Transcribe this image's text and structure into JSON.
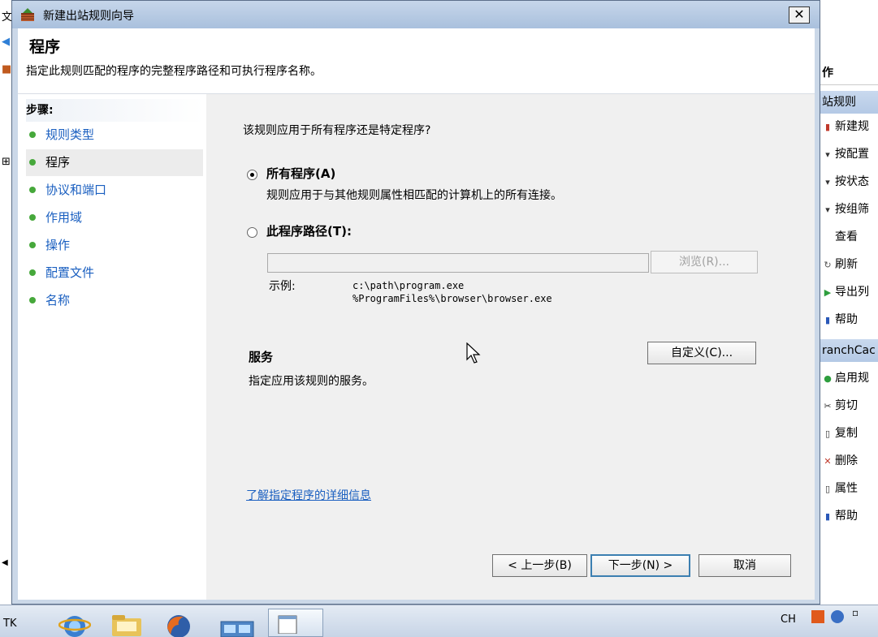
{
  "wizard": {
    "title": "新建出站规则向导",
    "close_glyph": "✕",
    "heading": "程序",
    "description": "指定此规则匹配的程序的完整程序路径和可执行程序名称。"
  },
  "steps": {
    "caption": "步骤:",
    "items": [
      {
        "label": "规则类型",
        "active": false
      },
      {
        "label": "程序",
        "active": true
      },
      {
        "label": "协议和端口",
        "active": false
      },
      {
        "label": "作用域",
        "active": false
      },
      {
        "label": "操作",
        "active": false
      },
      {
        "label": "配置文件",
        "active": false
      },
      {
        "label": "名称",
        "active": false
      }
    ]
  },
  "content": {
    "question": "该规则应用于所有程序还是特定程序?",
    "all_programs": {
      "label": "所有程序(A)",
      "description": "规则应用于与其他规则属性相匹配的计算机上的所有连接。",
      "selected": true
    },
    "this_program": {
      "label": "此程序路径(T):",
      "selected": false,
      "path_value": "",
      "browse_label": "浏览(R)..."
    },
    "example_label": "示例:",
    "example_line1": "c:\\path\\program.exe",
    "example_line2": "%ProgramFiles%\\browser\\browser.exe",
    "services_title": "服务",
    "services_desc": "指定应用该规则的服务。",
    "customize_label": "自定义(C)...",
    "learn_more": "了解指定程序的详细信息"
  },
  "footer": {
    "back_label": "< 上一步(B)",
    "next_label": "下一步(N) >",
    "cancel_label": "取消"
  },
  "background": {
    "left_chars": [
      "文",
      "",
      "",
      "",
      "",
      "",
      "⊞"
    ],
    "right_pane": {
      "header": "作",
      "section1": "站规则",
      "actions1": [
        {
          "icon": "new-rule-icon",
          "label": "新建规"
        },
        {
          "icon": "filter-icon",
          "label": "按配置"
        },
        {
          "icon": "filter-icon",
          "label": "按状态"
        },
        {
          "icon": "filter-icon",
          "label": "按组筛"
        },
        {
          "icon": "view-icon",
          "label": "查看"
        },
        {
          "icon": "refresh-icon",
          "label": "刷新"
        },
        {
          "icon": "export-icon",
          "label": "导出列"
        },
        {
          "icon": "help-icon",
          "label": "帮助"
        }
      ],
      "section2": "ranchCac",
      "actions2": [
        {
          "icon": "enable-icon",
          "label": "启用规"
        },
        {
          "icon": "cut-icon",
          "label": "剪切"
        },
        {
          "icon": "copy-icon",
          "label": "复制"
        },
        {
          "icon": "delete-icon",
          "label": "删除"
        },
        {
          "icon": "properties-icon",
          "label": "属性"
        },
        {
          "icon": "help-icon",
          "label": "帮助"
        }
      ]
    }
  },
  "taskbar": {
    "start_text": "TK",
    "tray_lang": "CH"
  }
}
